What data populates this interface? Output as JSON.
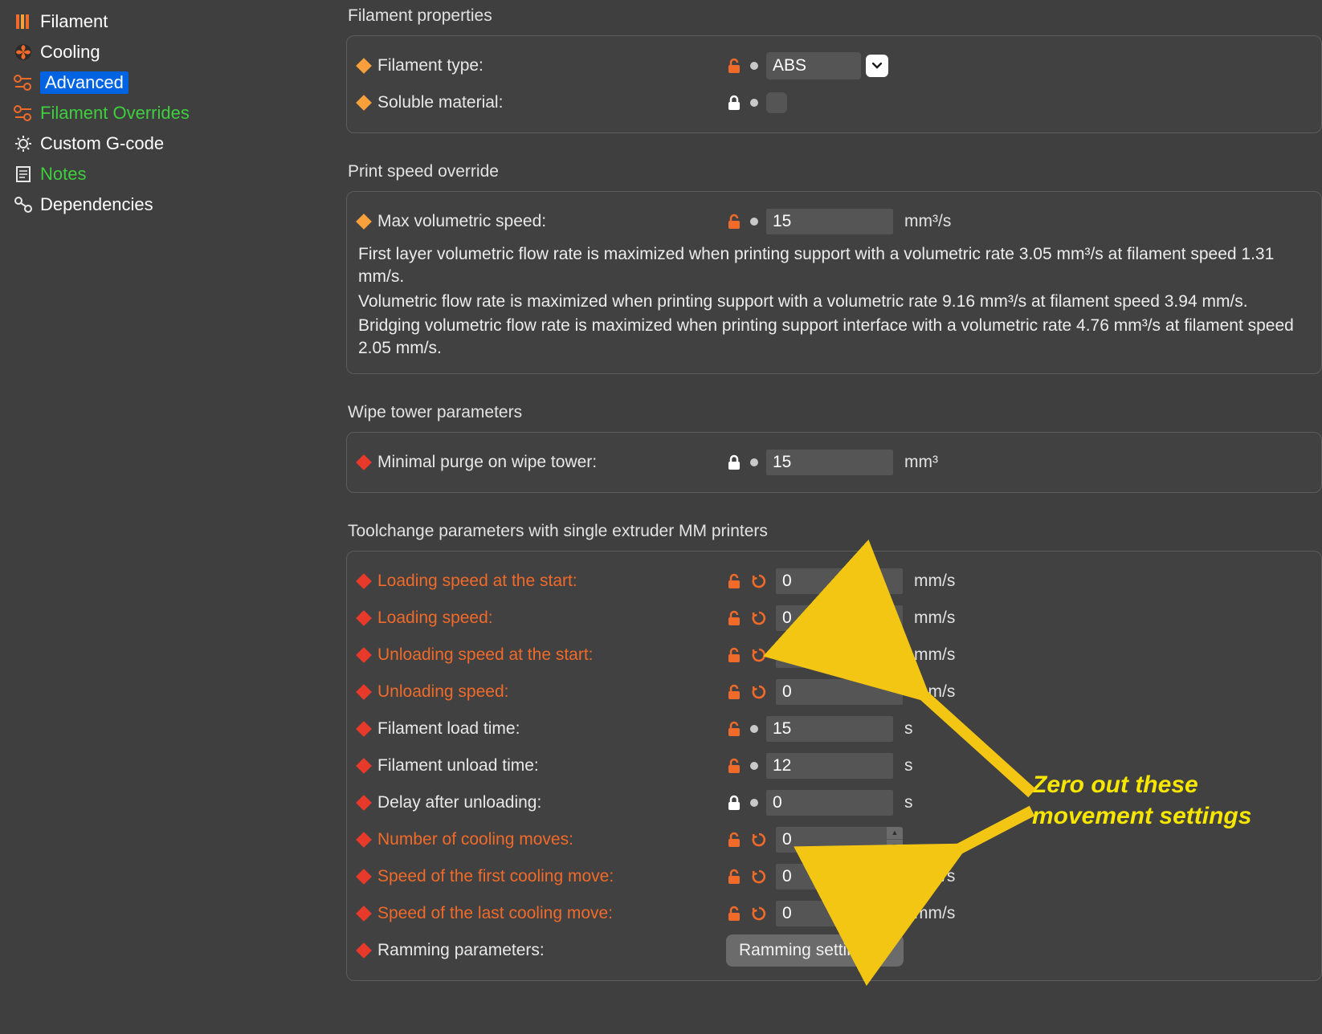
{
  "sidebar": {
    "items": [
      {
        "label": "Filament",
        "selected": false,
        "green": false
      },
      {
        "label": "Cooling",
        "selected": false,
        "green": false
      },
      {
        "label": "Advanced",
        "selected": true,
        "green": false
      },
      {
        "label": "Filament Overrides",
        "selected": false,
        "green": true
      },
      {
        "label": "Custom G-code",
        "selected": false,
        "green": false
      },
      {
        "label": "Notes",
        "selected": false,
        "green": true
      },
      {
        "label": "Dependencies",
        "selected": false,
        "green": false
      }
    ]
  },
  "groups": {
    "filament_properties": {
      "title": "Filament properties",
      "filament_type": {
        "label": "Filament type:",
        "value": "ABS"
      },
      "soluble": {
        "label": "Soluble material:",
        "checked": false
      }
    },
    "print_speed_override": {
      "title": "Print speed override",
      "max_vol": {
        "label": "Max volumetric speed:",
        "value": "15",
        "unit": "mm³/s"
      },
      "info_lines": [
        "First layer volumetric flow rate is maximized when printing support with a volumetric rate 3.05 mm³/s at filament speed 1.31 mm/s.",
        "Volumetric flow rate is maximized when printing support with a volumetric rate 9.16 mm³/s at filament speed 3.94 mm/s.",
        "Bridging volumetric flow rate is maximized when printing support interface with a volumetric rate 4.76 mm³/s at filament speed 2.05 mm/s."
      ]
    },
    "wipe_tower": {
      "title": "Wipe tower parameters",
      "min_purge": {
        "label": "Minimal purge on wipe tower:",
        "value": "15",
        "unit": "mm³"
      }
    },
    "toolchange": {
      "title": "Toolchange parameters with single extruder MM printers",
      "rows": [
        {
          "key": "loading_start",
          "label": "Loading speed at the start:",
          "value": "0",
          "unit": "mm/s",
          "orange": true,
          "reset": true,
          "lock": "orange"
        },
        {
          "key": "loading",
          "label": "Loading speed:",
          "value": "0",
          "unit": "mm/s",
          "orange": true,
          "reset": true,
          "lock": "orange"
        },
        {
          "key": "unloading_start",
          "label": "Unloading speed at the start:",
          "value": "0",
          "unit": "mm/s",
          "orange": true,
          "reset": true,
          "lock": "orange"
        },
        {
          "key": "unloading",
          "label": "Unloading speed:",
          "value": "0",
          "unit": "mm/s",
          "orange": true,
          "reset": true,
          "lock": "orange"
        },
        {
          "key": "load_time",
          "label": "Filament load time:",
          "value": "15",
          "unit": "s",
          "orange": false,
          "reset": false,
          "lock": "orange"
        },
        {
          "key": "unload_time",
          "label": "Filament unload time:",
          "value": "12",
          "unit": "s",
          "orange": false,
          "reset": false,
          "lock": "orange"
        },
        {
          "key": "delay",
          "label": "Delay after unloading:",
          "value": "0",
          "unit": "s",
          "orange": false,
          "reset": false,
          "lock": "white"
        },
        {
          "key": "cooling_moves",
          "label": "Number of cooling moves:",
          "value": "0",
          "unit": "",
          "orange": true,
          "reset": true,
          "lock": "orange",
          "spinner": true
        },
        {
          "key": "first_cool",
          "label": "Speed of the first cooling move:",
          "value": "0",
          "unit": "mm/s",
          "orange": true,
          "reset": true,
          "lock": "orange"
        },
        {
          "key": "last_cool",
          "label": "Speed of the last cooling move:",
          "value": "0",
          "unit": "mm/s",
          "orange": true,
          "reset": true,
          "lock": "orange"
        }
      ],
      "ramming": {
        "label": "Ramming parameters:",
        "button": "Ramming settings…"
      }
    }
  },
  "annotation": {
    "line1": "Zero out these",
    "line2": "movement settings"
  },
  "colors": {
    "accent_orange": "#F06A2A",
    "accent_yellow": "#F7A03C",
    "accent_red": "#E83A2A",
    "selection_blue": "#0063E1",
    "green": "#3ECF3E",
    "anno_yellow": "#F7E600"
  }
}
